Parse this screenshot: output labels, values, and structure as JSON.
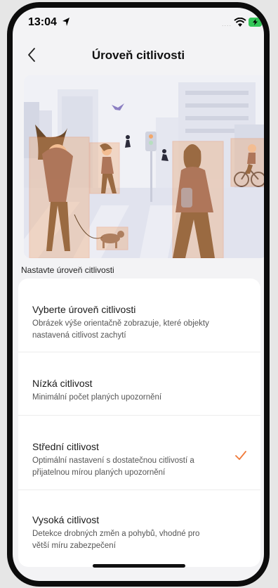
{
  "status": {
    "time": "13:04"
  },
  "header": {
    "title": "Úroveň citlivosti",
    "back_icon": "chevron-left-icon"
  },
  "illustration": {
    "icon": "pedestrian-detection-illustration"
  },
  "caption": "Nastavte úroveň citlivosti",
  "intro": {
    "title": "Vyberte úroveň citlivosti",
    "description": "Obrázek výše orientačně zobrazuje, které objekty nastavená citlivost zachytí"
  },
  "options": [
    {
      "title": "Nízká citlivost",
      "description": "Minimální počet planých upozornění",
      "selected": false
    },
    {
      "title": "Střední citlivost",
      "description": "Optimální nastavení s dostatečnou citlivostí a přijatelnou mírou planých upozornění",
      "selected": true
    },
    {
      "title": "Vysoká citlivost",
      "description": "Detekce drobných změn a pohybů, vhodné pro větší míru zabezpečení",
      "selected": false
    }
  ],
  "colors": {
    "accent": "#f07a3a",
    "box": "#f2a76b",
    "person": "#8a5c52",
    "hair": "#6b4a2c"
  }
}
